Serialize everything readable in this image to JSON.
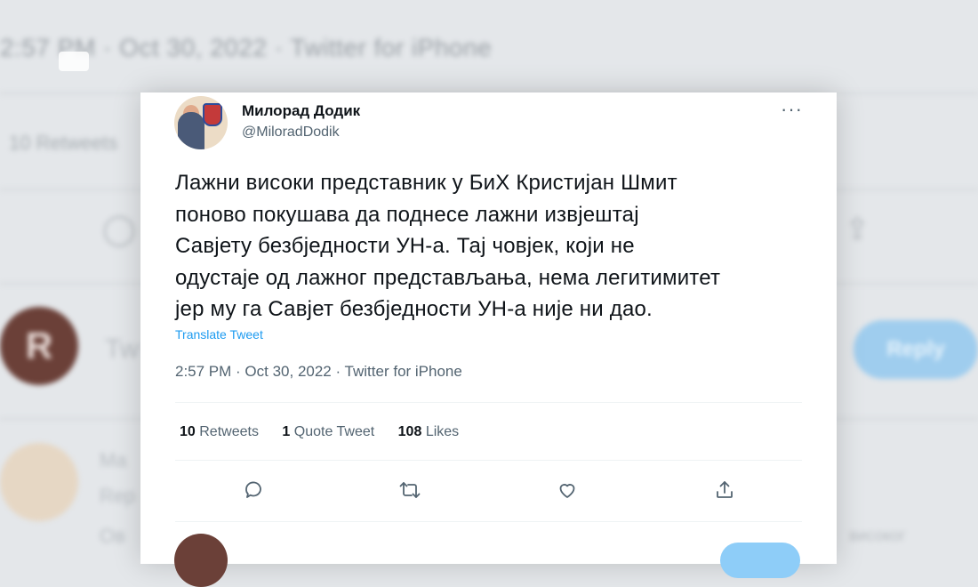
{
  "background": {
    "timestamp": "2:57 PM · Oct 30, 2022 · Twitter for iPhone",
    "retweets_partial": "10 Retweets",
    "reply_avatar_letter": "R",
    "reply_button": "Reply",
    "reply_input_partial": "Tw",
    "bg_name_partial": "Ma",
    "bg_reply_partial": "Rep",
    "bg_text_partial": "Ов",
    "bg_text_right": "високог"
  },
  "tweet": {
    "author_name": "Милорад Додик",
    "author_handle": "@MiloradDodik",
    "more_icon": "more-horizontal-icon",
    "text_lines": [
      "Лажни високи представник у БиХ Кристијан Шмит",
      "поново покушава да поднесе лажни извјештај",
      "Савјету безбједности УН-а. Тај човјек, који не",
      "одустаје од лажног представљања, нема легитимитет",
      "јер му га Савјет безбједности УН-а није ни дао."
    ],
    "translate_label": "Translate Tweet",
    "timestamp": "2:57 PM · Oct 30, 2022 · Twitter for iPhone",
    "stats": {
      "retweets_count": "10",
      "retweets_label": "Retweets",
      "quotes_count": "1",
      "quotes_label": "Quote Tweet",
      "likes_count": "108",
      "likes_label": "Likes"
    },
    "actions": {
      "reply_icon": "reply-icon",
      "retweet_icon": "retweet-icon",
      "like_icon": "heart-icon",
      "share_icon": "share-icon"
    }
  },
  "colors": {
    "text": "#0f1419",
    "secondary": "#536471",
    "link": "#1d9bf0"
  }
}
